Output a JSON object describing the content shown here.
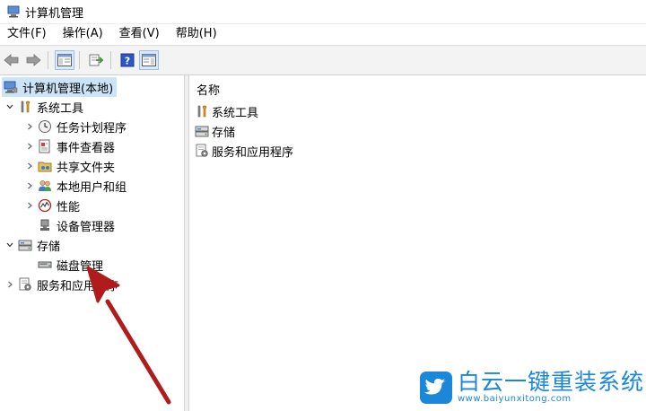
{
  "window": {
    "title": "计算机管理"
  },
  "menu": [
    "文件(F)",
    "操作(A)",
    "查看(V)",
    "帮助(H)"
  ],
  "toolbar": {
    "buttons": [
      "back-icon",
      "forward-icon",
      "show-tree-icon",
      "export-list-icon",
      "help-icon",
      "show-action-pane-icon"
    ]
  },
  "tree": {
    "root": "计算机管理(本地)",
    "system_tools": "系统工具",
    "task_scheduler": "任务计划程序",
    "event_viewer": "事件查看器",
    "shared_folders": "共享文件夹",
    "local_users": "本地用户和组",
    "performance": "性能",
    "device_manager": "设备管理器",
    "storage": "存储",
    "disk_management": "磁盘管理",
    "services_apps": "服务和应用程序"
  },
  "list": {
    "column_name": "名称",
    "items": [
      "系统工具",
      "存储",
      "服务和应用程序"
    ]
  },
  "watermark": {
    "title": "白云一键重装系统",
    "url": "www.baiyunxitong.com"
  },
  "colors": {
    "selection": "#cce4f7",
    "arrow": "#b01c1c",
    "brand": "#1a87d8"
  }
}
